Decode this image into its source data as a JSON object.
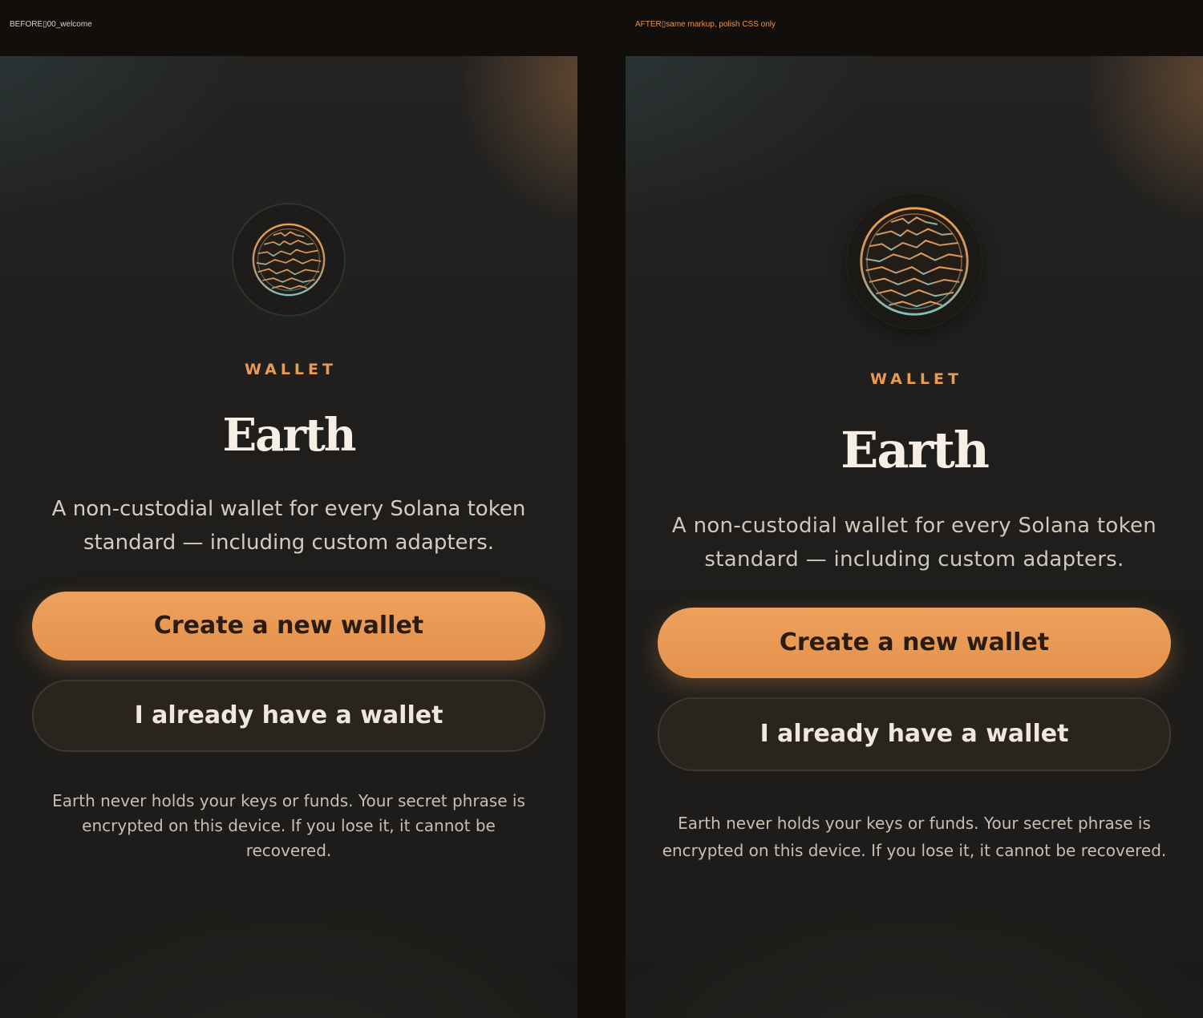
{
  "captions": {
    "before": "BEFORE▯00_welcome",
    "after": "AFTER▯same markup, polish CSS only"
  },
  "screen": {
    "logo_icon": "earth-globe-icon",
    "eyebrow": "WALLET",
    "title": "Earth",
    "tagline": "A non-custodial wallet for every Solana token standard — including custom adapters.",
    "create_button": "Create a new wallet",
    "import_button": "I already have a wallet",
    "disclaimer": "Earth never holds your keys or funds. Your secret phrase is encrypted on this device. If you lose it, it cannot be recovered."
  },
  "colors": {
    "accent": "#e89b55",
    "background": "#1f1e1c",
    "title": "#f7efe6",
    "secondary_button": "#2a241e"
  }
}
